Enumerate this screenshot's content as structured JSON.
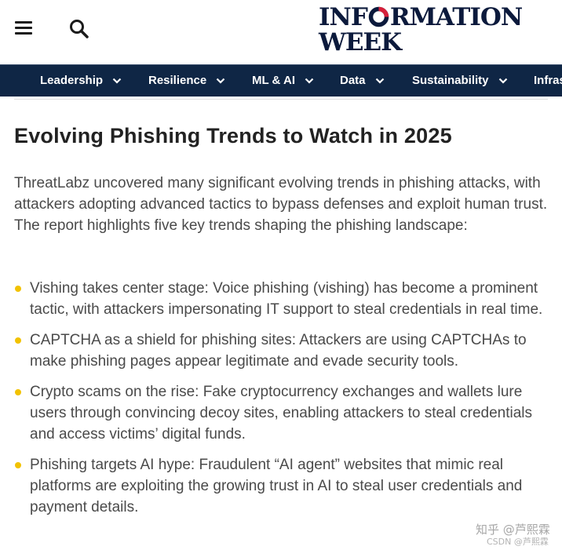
{
  "header": {
    "menu_icon": "hamburger-menu-icon",
    "search_icon": "search-icon",
    "logo": {
      "line1_before": "INF",
      "line1_after": "RMATION",
      "line2": "WEEK",
      "brand_colors": {
        "navy": "#0c1a3c",
        "red": "#d6203a"
      }
    }
  },
  "nav": {
    "background": "#0f2645",
    "items": [
      {
        "label": "Leadership"
      },
      {
        "label": "Resilience"
      },
      {
        "label": "ML & AI"
      },
      {
        "label": "Data"
      },
      {
        "label": "Sustainability"
      },
      {
        "label": "Infras"
      }
    ]
  },
  "article": {
    "title": "Evolving Phishing Trends to Watch in 2025",
    "intro": "ThreatLabz uncovered many significant evolving trends in phishing attacks, with attackers adopting advanced tactics to bypass defenses and exploit human trust. The report highlights five key trends shaping the phishing landscape:",
    "bullet_color": "#f2c200",
    "trends": [
      {
        "text": "Vishing takes center stage: Voice phishing (vishing) has become a prominent tactic, with attackers impersonating IT support to steal credentials in real time."
      },
      {
        "text": "CAPTCHA as a shield for phishing sites: Attackers are using CAPTCHAs to make phishing pages appear legitimate and evade security tools."
      },
      {
        "text": "Crypto scams on the rise: Fake cryptocurrency exchanges and wallets lure users through convincing decoy sites, enabling attackers to steal credentials and access victims’ digital funds."
      },
      {
        "text": "Phishing targets AI hype: Fraudulent “AI agent” websites that mimic real platforms are exploiting the growing trust in AI to steal user credentials and payment details."
      }
    ]
  },
  "watermark": {
    "line1": "知乎 @芦熙霖",
    "line2": "CSDN @芦熙霖"
  }
}
